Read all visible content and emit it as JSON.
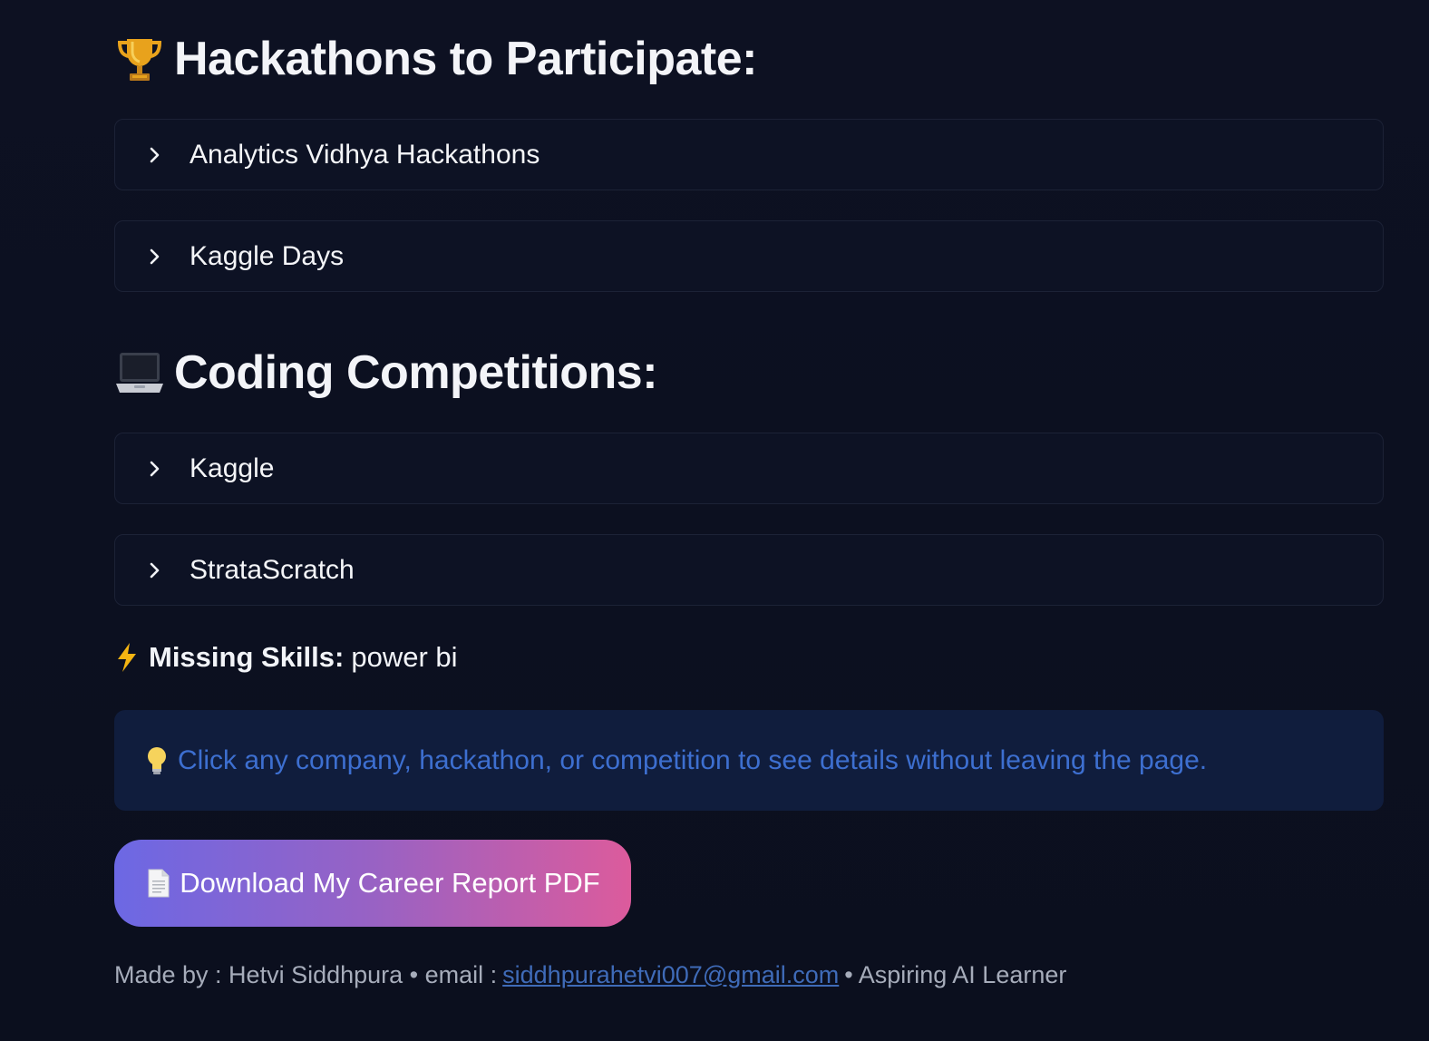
{
  "sections": {
    "hackathons": {
      "title": "Hackathons to Participate:",
      "icon": "trophy-icon",
      "items": [
        {
          "label": "Analytics Vidhya Hackathons"
        },
        {
          "label": "Kaggle Days"
        }
      ]
    },
    "coding": {
      "title": "Coding Competitions:",
      "icon": "laptop-icon",
      "items": [
        {
          "label": "Kaggle"
        },
        {
          "label": "StrataScratch"
        }
      ]
    }
  },
  "missing_skills": {
    "icon": "lightning-icon",
    "label": "Missing Skills:",
    "value": "power bi"
  },
  "info": {
    "icon": "lightbulb-icon",
    "text": "Click any company, hackathon, or competition to see details without leaving the page."
  },
  "download_button": {
    "icon": "document-icon",
    "label": "Download My Career Report PDF"
  },
  "footer": {
    "made_by": "Made by : Hetvi Siddhpura • email :",
    "email": "siddhpurahetvi007@gmail.com",
    "tagline": "• Aspiring AI Learner"
  },
  "colors": {
    "background": "#0c1020",
    "info_box": "#101d3d",
    "info_text": "#3d6fd0",
    "button_gradient_start": "#6c68e4",
    "button_gradient_end": "#dc5b9c",
    "link": "#3f6bb8"
  }
}
